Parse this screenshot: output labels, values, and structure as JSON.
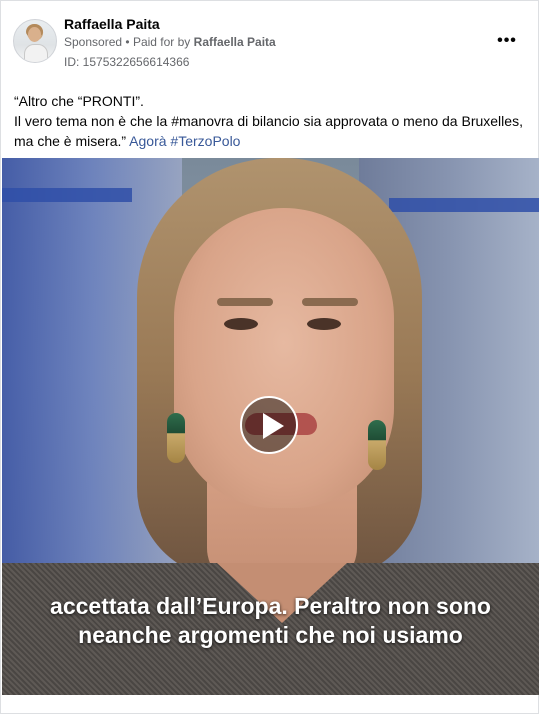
{
  "post": {
    "author": "Raffaella Paita",
    "sponsored_label": "Sponsored",
    "separator": "•",
    "paid_for_prefix": "Paid for by",
    "paid_for_name": "Raffaella Paita",
    "ad_id": "ID: 1575322656614366",
    "more_options_icon": "more-horizontal-icon",
    "caption": {
      "line1": "“Altro che “PRONTI”.",
      "line2": "Il vero tema non è che la #manovra di bilancio sia approvata o meno da Bruxelles, ma che è misera.”",
      "link_text": "Agorà",
      "hashtag": "#TerzoPolo"
    }
  },
  "video": {
    "play_icon": "play-icon",
    "subtitle_line1": "accettata dall’Europa. Peraltro non sono",
    "subtitle_line2": "neanche argomenti che noi usiamo"
  },
  "colors": {
    "link": "#385898",
    "meta_text": "#65676b",
    "border": "#dddfe2"
  }
}
